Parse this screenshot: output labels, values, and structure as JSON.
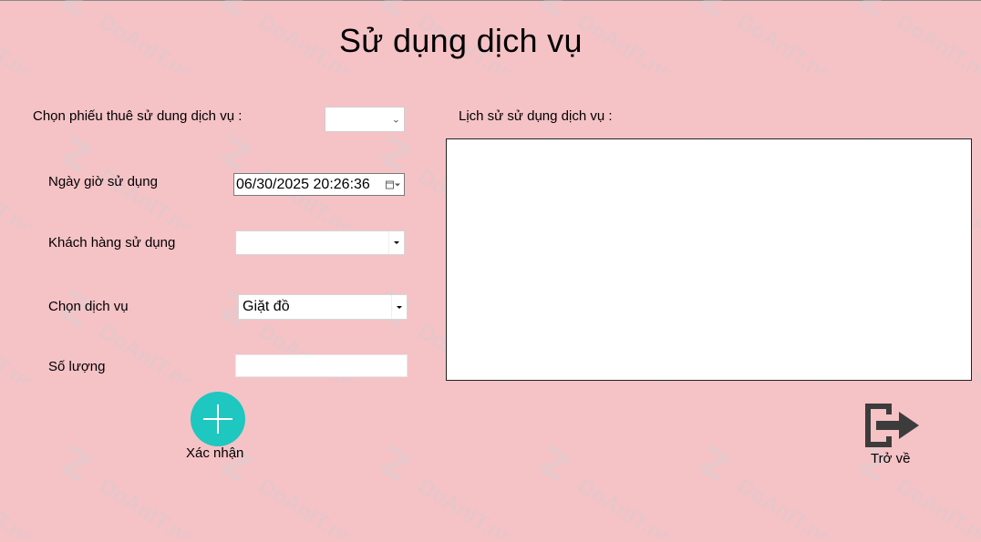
{
  "form": {
    "title": "Sử dụng dịch vụ",
    "rental_slip_label": "Chọn phiếu thuê sử dung dịch vụ :",
    "rental_slip_value": "",
    "datetime_label": "Ngày giờ sử dụng",
    "datetime_value": "06/30/2025 20:26:36",
    "customer_label": "Khách hàng sử dụng",
    "customer_value": "",
    "service_label": "Chọn dịch vụ",
    "service_value": "Giặt đồ",
    "quantity_label": "Số lượng",
    "quantity_value": ""
  },
  "history": {
    "label": "Lịch sử sử dụng dịch vụ :"
  },
  "actions": {
    "confirm_label": "Xác nhận",
    "back_label": "Trở về"
  },
  "watermark": {
    "text": "DoAnIT.net"
  },
  "colors": {
    "background": "#f5c2c6",
    "confirm_button": "#1ec7c0",
    "exit_icon": "#3c3c3c"
  },
  "icons": {
    "confirm": "plus-icon",
    "back": "exit-door-arrow-icon",
    "dropdown": "chevron-down-icon",
    "calendar": "calendar-icon"
  }
}
